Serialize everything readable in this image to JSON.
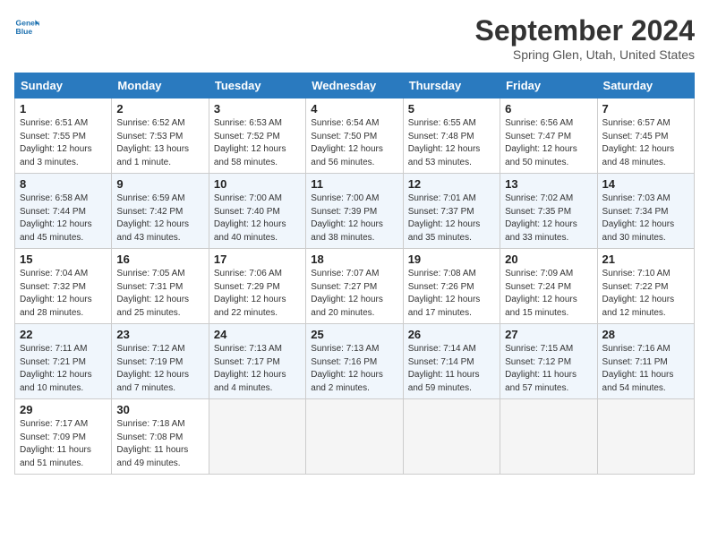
{
  "header": {
    "logo_line1": "General",
    "logo_line2": "Blue",
    "title": "September 2024",
    "subtitle": "Spring Glen, Utah, United States"
  },
  "columns": [
    "Sunday",
    "Monday",
    "Tuesday",
    "Wednesday",
    "Thursday",
    "Friday",
    "Saturday"
  ],
  "weeks": [
    [
      {
        "day": "1",
        "sunrise": "6:51 AM",
        "sunset": "7:55 PM",
        "daylight": "12 hours and 3 minutes."
      },
      {
        "day": "2",
        "sunrise": "6:52 AM",
        "sunset": "7:53 PM",
        "daylight": "13 hours and 1 minute."
      },
      {
        "day": "3",
        "sunrise": "6:53 AM",
        "sunset": "7:52 PM",
        "daylight": "12 hours and 58 minutes."
      },
      {
        "day": "4",
        "sunrise": "6:54 AM",
        "sunset": "7:50 PM",
        "daylight": "12 hours and 56 minutes."
      },
      {
        "day": "5",
        "sunrise": "6:55 AM",
        "sunset": "7:48 PM",
        "daylight": "12 hours and 53 minutes."
      },
      {
        "day": "6",
        "sunrise": "6:56 AM",
        "sunset": "7:47 PM",
        "daylight": "12 hours and 50 minutes."
      },
      {
        "day": "7",
        "sunrise": "6:57 AM",
        "sunset": "7:45 PM",
        "daylight": "12 hours and 48 minutes."
      }
    ],
    [
      {
        "day": "8",
        "sunrise": "6:58 AM",
        "sunset": "7:44 PM",
        "daylight": "12 hours and 45 minutes."
      },
      {
        "day": "9",
        "sunrise": "6:59 AM",
        "sunset": "7:42 PM",
        "daylight": "12 hours and 43 minutes."
      },
      {
        "day": "10",
        "sunrise": "7:00 AM",
        "sunset": "7:40 PM",
        "daylight": "12 hours and 40 minutes."
      },
      {
        "day": "11",
        "sunrise": "7:00 AM",
        "sunset": "7:39 PM",
        "daylight": "12 hours and 38 minutes."
      },
      {
        "day": "12",
        "sunrise": "7:01 AM",
        "sunset": "7:37 PM",
        "daylight": "12 hours and 35 minutes."
      },
      {
        "day": "13",
        "sunrise": "7:02 AM",
        "sunset": "7:35 PM",
        "daylight": "12 hours and 33 minutes."
      },
      {
        "day": "14",
        "sunrise": "7:03 AM",
        "sunset": "7:34 PM",
        "daylight": "12 hours and 30 minutes."
      }
    ],
    [
      {
        "day": "15",
        "sunrise": "7:04 AM",
        "sunset": "7:32 PM",
        "daylight": "12 hours and 28 minutes."
      },
      {
        "day": "16",
        "sunrise": "7:05 AM",
        "sunset": "7:31 PM",
        "daylight": "12 hours and 25 minutes."
      },
      {
        "day": "17",
        "sunrise": "7:06 AM",
        "sunset": "7:29 PM",
        "daylight": "12 hours and 22 minutes."
      },
      {
        "day": "18",
        "sunrise": "7:07 AM",
        "sunset": "7:27 PM",
        "daylight": "12 hours and 20 minutes."
      },
      {
        "day": "19",
        "sunrise": "7:08 AM",
        "sunset": "7:26 PM",
        "daylight": "12 hours and 17 minutes."
      },
      {
        "day": "20",
        "sunrise": "7:09 AM",
        "sunset": "7:24 PM",
        "daylight": "12 hours and 15 minutes."
      },
      {
        "day": "21",
        "sunrise": "7:10 AM",
        "sunset": "7:22 PM",
        "daylight": "12 hours and 12 minutes."
      }
    ],
    [
      {
        "day": "22",
        "sunrise": "7:11 AM",
        "sunset": "7:21 PM",
        "daylight": "12 hours and 10 minutes."
      },
      {
        "day": "23",
        "sunrise": "7:12 AM",
        "sunset": "7:19 PM",
        "daylight": "12 hours and 7 minutes."
      },
      {
        "day": "24",
        "sunrise": "7:13 AM",
        "sunset": "7:17 PM",
        "daylight": "12 hours and 4 minutes."
      },
      {
        "day": "25",
        "sunrise": "7:13 AM",
        "sunset": "7:16 PM",
        "daylight": "12 hours and 2 minutes."
      },
      {
        "day": "26",
        "sunrise": "7:14 AM",
        "sunset": "7:14 PM",
        "daylight": "11 hours and 59 minutes."
      },
      {
        "day": "27",
        "sunrise": "7:15 AM",
        "sunset": "7:12 PM",
        "daylight": "11 hours and 57 minutes."
      },
      {
        "day": "28",
        "sunrise": "7:16 AM",
        "sunset": "7:11 PM",
        "daylight": "11 hours and 54 minutes."
      }
    ],
    [
      {
        "day": "29",
        "sunrise": "7:17 AM",
        "sunset": "7:09 PM",
        "daylight": "11 hours and 51 minutes."
      },
      {
        "day": "30",
        "sunrise": "7:18 AM",
        "sunset": "7:08 PM",
        "daylight": "11 hours and 49 minutes."
      },
      null,
      null,
      null,
      null,
      null
    ]
  ]
}
